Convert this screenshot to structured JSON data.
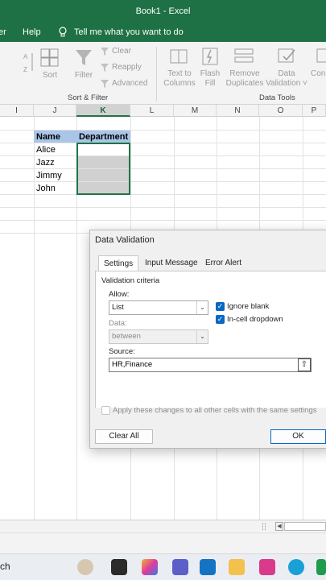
{
  "window": {
    "title": "Book1  -  Excel"
  },
  "menu": {
    "items": [
      "er",
      "Help"
    ],
    "tell_me": "Tell me what you want to do"
  },
  "ribbon": {
    "sort": "Sort",
    "filter": "Filter",
    "clear": "Clear",
    "reapply": "Reapply",
    "advanced": "Advanced",
    "sort_filter_label": "Sort & Filter",
    "text_to_columns": [
      "Text to",
      "Columns"
    ],
    "flash_fill": [
      "Flash",
      "Fill"
    ],
    "remove_duplicates": [
      "Remove",
      "Duplicates"
    ],
    "data_validation": [
      "Data",
      "Validation ˅"
    ],
    "cons": [
      "",
      "Con"
    ],
    "data_tools_label": "Data Tools"
  },
  "sheet": {
    "columns": [
      "I",
      "J",
      "K",
      "L",
      "M",
      "N",
      "O",
      "P"
    ],
    "selected_column": "K",
    "header_name": "Name",
    "header_department": "Department",
    "names": [
      "Alice",
      "Jazz",
      "Jimmy",
      "John"
    ]
  },
  "dialog": {
    "title": "Data Validation",
    "tabs": [
      "Settings",
      "Input Message",
      "Error Alert"
    ],
    "section": "Validation criteria",
    "allow_label": "Allow:",
    "allow_value": "List",
    "data_label": "Data:",
    "data_value": "between",
    "ignore_blank": "Ignore blank",
    "in_cell_dropdown": "In-cell dropdown",
    "source_label": "Source:",
    "source_value": "HR,Finance",
    "apply_all": "Apply these changes to all other cells with the same settings",
    "clear_all": "Clear All",
    "ok": "OK"
  },
  "taskbar": {
    "search": "ch"
  },
  "colors": {
    "excel_green": "#1e7145",
    "header_fill": "#a9c6e8",
    "check_blue": "#0a67c2"
  }
}
